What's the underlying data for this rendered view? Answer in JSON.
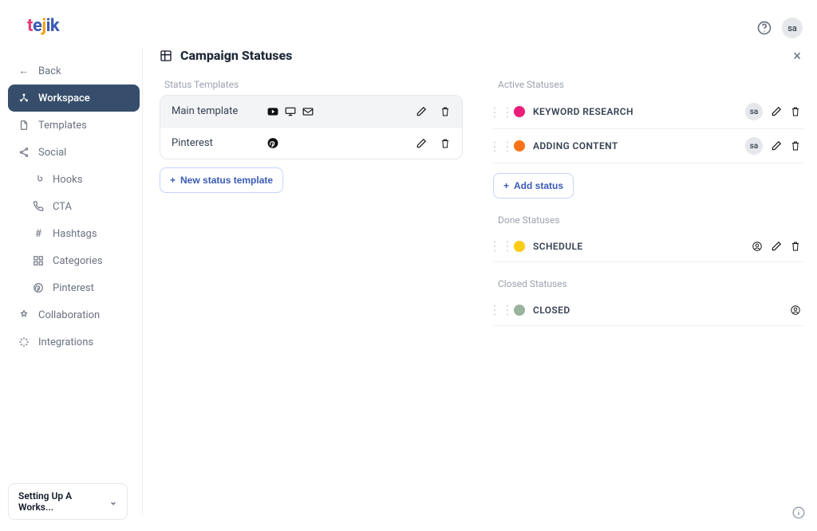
{
  "brand": {
    "t1": "t",
    "t2": "e",
    "t3": "j",
    "t4": "ik"
  },
  "header": {
    "avatar": "sa"
  },
  "sidebar": {
    "back": "Back",
    "workspace": "Workspace",
    "templates": "Templates",
    "social": "Social",
    "hooks": "Hooks",
    "cta": "CTA",
    "hashtags": "Hashtags",
    "categories": "Categories",
    "pinterest": "Pinterest",
    "collaboration": "Collaboration",
    "integrations": "Integrations"
  },
  "bottom": {
    "label": "Setting Up A Works..."
  },
  "page": {
    "title": "Campaign Statuses",
    "templates_head": "Status Templates",
    "templates": [
      {
        "name": "Main template",
        "icons": [
          "youtube",
          "desktop",
          "mail"
        ],
        "selected": true
      },
      {
        "name": "Pinterest",
        "icons": [
          "pinterest"
        ],
        "selected": false
      }
    ],
    "new_template": "New status template",
    "groups": {
      "active": {
        "title": "Active Statuses",
        "rows": [
          {
            "name": "KEYWORD RESEARCH",
            "color": "#ec1e79",
            "chip": "sa",
            "edit": true,
            "del": true
          },
          {
            "name": "ADDING CONTENT",
            "color": "#f97316",
            "chip": "sa",
            "edit": true,
            "del": true
          }
        ],
        "add": "Add status"
      },
      "done": {
        "title": "Done Statuses",
        "rows": [
          {
            "name": "SCHEDULE",
            "color": "#facc15",
            "user_ic": true,
            "edit": true,
            "del": true
          }
        ]
      },
      "closed": {
        "title": "Closed Statuses",
        "rows": [
          {
            "name": "CLOSED",
            "color": "#9ab39d",
            "user_ic": true
          }
        ]
      }
    }
  }
}
